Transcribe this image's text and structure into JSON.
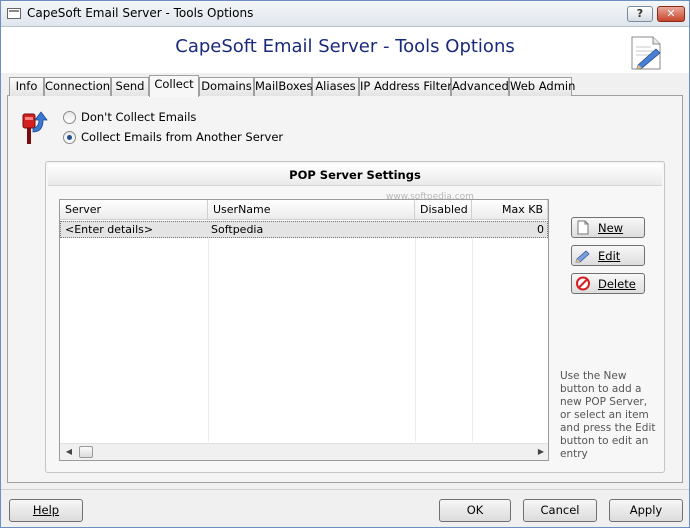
{
  "window": {
    "title": "CapeSoft Email Server - Tools Options",
    "heading": "CapeSoft Email Server - Tools Options",
    "help_glyph": "?",
    "close_glyph": "✕"
  },
  "tabs": [
    {
      "label": "Info"
    },
    {
      "label": "Connection"
    },
    {
      "label": "Send"
    },
    {
      "label": "Collect"
    },
    {
      "label": "Domains"
    },
    {
      "label": "MailBoxes"
    },
    {
      "label": "Aliases"
    },
    {
      "label": "IP Address Filter"
    },
    {
      "label": "Advanced"
    },
    {
      "label": "Web Admin"
    }
  ],
  "active_tab": "Collect",
  "collect": {
    "options": [
      {
        "label": "Don't Collect Emails",
        "checked": false
      },
      {
        "label": "Collect Emails from Another Server",
        "checked": true
      }
    ]
  },
  "pop_group": {
    "title": "POP Server Settings",
    "watermark": "www.softpedia.com",
    "columns": [
      "Server",
      "UserName",
      "Disabled",
      "Max KB"
    ],
    "rows": [
      {
        "server": "<Enter details>",
        "username": "Softpedia",
        "disabled": "",
        "max_kb": "0"
      }
    ],
    "buttons": {
      "new": "New",
      "edit": "Edit",
      "delete": "Delete"
    },
    "hint": "Use the New button to add a new POP Server, or select an item and press the Edit button to edit an entry"
  },
  "footer": {
    "help": "Help",
    "ok": "OK",
    "cancel": "Cancel",
    "apply": "Apply"
  },
  "colors": {
    "heading": "#1a2a7a",
    "selected_row": "#e4e4e4",
    "delete_icon": "#d42020"
  }
}
